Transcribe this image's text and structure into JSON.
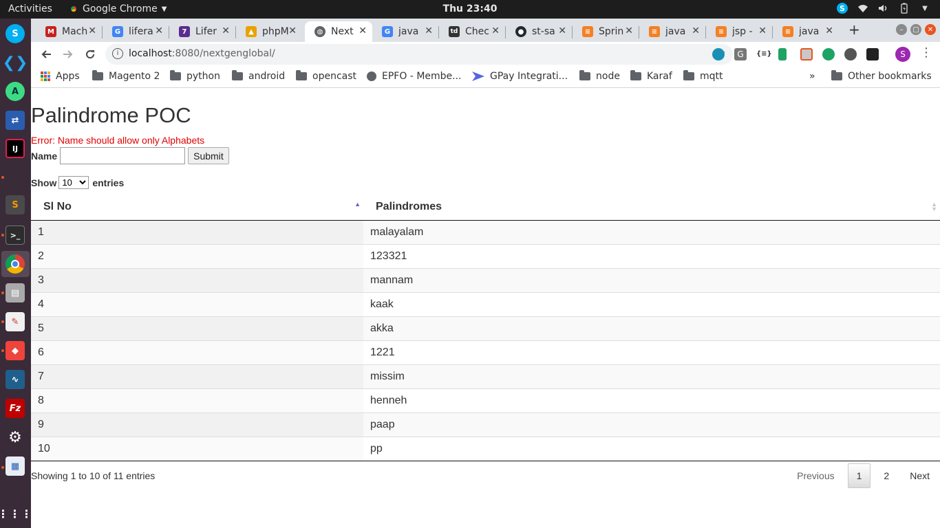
{
  "system": {
    "activities": "Activities",
    "app_name": "Google Chrome",
    "clock": "Thu 23:40"
  },
  "tabs": [
    {
      "title": "Mach",
      "color": "#c5221f",
      "glyph": "M"
    },
    {
      "title": "lifera",
      "color": "#4285f4",
      "glyph": "G"
    },
    {
      "title": "Lifer",
      "color": "#5b2c8f",
      "glyph": "7"
    },
    {
      "title": "phpM",
      "color": "#e8a300",
      "glyph": "▲"
    },
    {
      "title": "Next",
      "color": "#5f6368",
      "glyph": "◍"
    },
    {
      "title": "java",
      "color": "#4285f4",
      "glyph": "G"
    },
    {
      "title": "Chec",
      "color": "#333333",
      "glyph": "td"
    },
    {
      "title": "st-sa",
      "color": "#24292e",
      "glyph": "●"
    },
    {
      "title": "Sprin",
      "color": "#f48024",
      "glyph": "≡"
    },
    {
      "title": "java",
      "color": "#f48024",
      "glyph": "≡"
    },
    {
      "title": "jsp -",
      "color": "#f48024",
      "glyph": "≡"
    },
    {
      "title": "java",
      "color": "#f48024",
      "glyph": "≡"
    }
  ],
  "omnibox": {
    "host": "localhost",
    "path": ":8080/nextgenglobal/"
  },
  "bookmarks": {
    "items": [
      "Apps",
      "Magento 2",
      "python",
      "android",
      "opencast",
      "EPFO - Membe...",
      "GPay Integrati...",
      "node",
      "Karaf",
      "mqtt"
    ],
    "overflow": "»",
    "other": "Other bookmarks"
  },
  "page": {
    "title": "Palindrome POC",
    "error": "Error: Name should allow only Alphabets",
    "name_label": "Name",
    "name_value": "",
    "submit_label": "Submit",
    "show_label": "Show",
    "page_size": "10",
    "entries_label": "entries",
    "columns": [
      "Sl No",
      "Palindromes"
    ],
    "rows": [
      [
        "1",
        "malayalam"
      ],
      [
        "2",
        "123321"
      ],
      [
        "3",
        "mannam"
      ],
      [
        "4",
        "kaak"
      ],
      [
        "5",
        "akka"
      ],
      [
        "6",
        "1221"
      ],
      [
        "7",
        "missim"
      ],
      [
        "8",
        "henneh"
      ],
      [
        "9",
        "paap"
      ],
      [
        "10",
        "pp"
      ]
    ],
    "info": "Showing 1 to 10 of 11 entries",
    "pagination": {
      "previous": "Previous",
      "pages": [
        "1",
        "2"
      ],
      "current": "1",
      "next": "Next"
    }
  }
}
